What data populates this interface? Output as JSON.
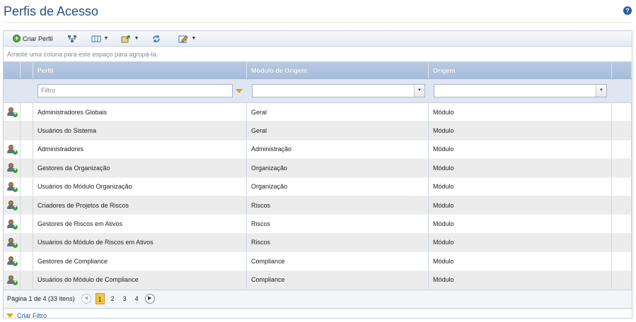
{
  "page": {
    "title": "Perfis de Acesso",
    "help_icon": "help-icon"
  },
  "toolbar": {
    "create_profile_label": "Criar Perfil",
    "icons": [
      "add-icon",
      "hierarchy-icon",
      "columns-icon",
      "export-icon",
      "refresh-icon",
      "edit-icon"
    ]
  },
  "grid": {
    "group_hint": "Arraste uma coluna para este espaço para agrupá-la.",
    "columns": {
      "profile": "Perfil",
      "module": "Módulo de Origem",
      "origin": "Origem"
    },
    "filter_placeholder": "Filtro",
    "rows": [
      {
        "icon": true,
        "profile": "Administradores Globais",
        "module": "Geral",
        "origin": "Módulo"
      },
      {
        "icon": false,
        "profile": "Usuários do Sistema",
        "module": "Geral",
        "origin": "Módulo"
      },
      {
        "icon": true,
        "profile": "Administradores",
        "module": "Administração",
        "origin": "Módulo"
      },
      {
        "icon": true,
        "profile": "Gestores da Organização",
        "module": "Organização",
        "origin": "Módulo"
      },
      {
        "icon": true,
        "profile": "Usuários do Módulo Organização",
        "module": "Organização",
        "origin": "Módulo"
      },
      {
        "icon": true,
        "profile": "Criadores de Projetos de Riscos",
        "module": "Riscos",
        "origin": "Módulo"
      },
      {
        "icon": true,
        "profile": "Gestores de Riscos em Ativos",
        "module": "Riscos",
        "origin": "Módulo"
      },
      {
        "icon": true,
        "profile": "Usuários do Módulo de Riscos em Ativos",
        "module": "Riscos",
        "origin": "Módulo"
      },
      {
        "icon": true,
        "profile": "Gestores de Compliance",
        "module": "Compliance",
        "origin": "Módulo"
      },
      {
        "icon": true,
        "profile": "Usuários do Módulo de Compliance",
        "module": "Compliance",
        "origin": "Módulo"
      }
    ]
  },
  "pager": {
    "info": "Página 1 de 4 (33 itens)",
    "pages": [
      "1",
      "2",
      "3",
      "4"
    ],
    "current": "1"
  },
  "footer": {
    "create_filter_label": "Criar Filtro"
  },
  "colors": {
    "title": "#2a4f86",
    "header": "#a9bedb",
    "active_page": "#f5c54a",
    "link": "#2a5aa0"
  }
}
